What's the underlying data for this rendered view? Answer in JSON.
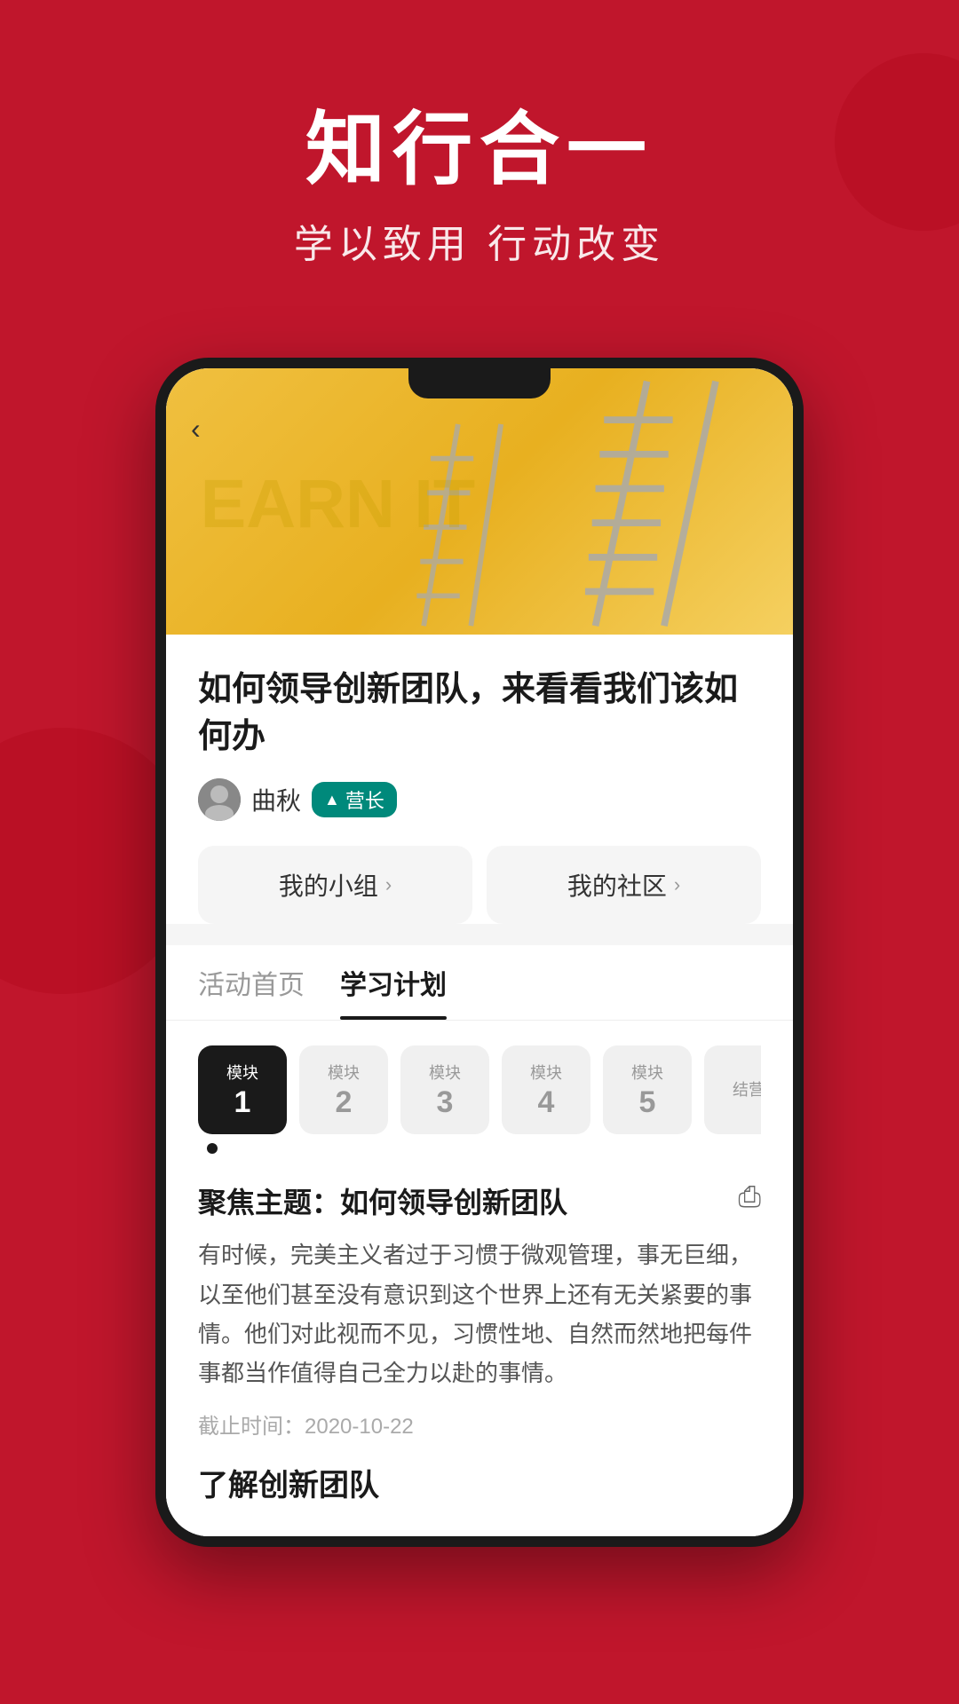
{
  "background": {
    "color": "#c0162c"
  },
  "header": {
    "title": "知行合一",
    "subtitle": "学以致用 行动改变"
  },
  "phone": {
    "hero": {
      "back_icon": "‹"
    },
    "article": {
      "title": "如何领导创新团队，来看看我们该如何办",
      "author": {
        "name": "曲秋",
        "badge_icon": "▲",
        "badge_text": "营长"
      }
    },
    "quick_nav": {
      "my_group": "我的小组",
      "my_community": "我的社区"
    },
    "tabs": [
      {
        "label": "活动首页",
        "active": false
      },
      {
        "label": "学习计划",
        "active": true
      }
    ],
    "modules": [
      {
        "label": "模块",
        "number": "1",
        "active": true
      },
      {
        "label": "模块",
        "number": "2",
        "active": false
      },
      {
        "label": "模块",
        "number": "3",
        "active": false
      },
      {
        "label": "模块",
        "number": "4",
        "active": false
      },
      {
        "label": "模块",
        "number": "5",
        "active": false
      },
      {
        "label": "结营",
        "number": "",
        "active": false
      }
    ],
    "content": {
      "section_title": "聚焦主题：如何领导创新团队",
      "body": "有时候，完美主义者过于习惯于微观管理，事无巨细，以至他们甚至没有意识到这个世界上还有无关紧要的事情。他们对此视而不见，习惯性地、自然而然地把每件事都当作值得自己全力以赴的事情。",
      "deadline": "截止时间：2020-10-22",
      "sub_title": "了解创新团队"
    }
  }
}
